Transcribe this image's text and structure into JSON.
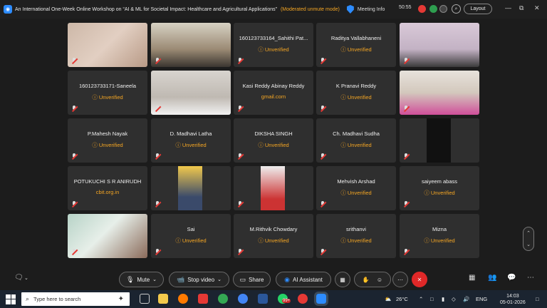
{
  "titlebar": {
    "title": "An International One-Week Online Workshop on “AI & ML for Societal Impact: Healthcare and Agricultural Applications”",
    "mode": "(Moderated unmute mode)",
    "meeting_info": "Meeting Info",
    "timer": "50:55",
    "layout_label": "Layout"
  },
  "participants": [
    {
      "name": "",
      "sub": ""
    },
    {
      "name": "",
      "sub": ""
    },
    {
      "name": "160123733164_Sahithi Pat...",
      "sub": "ⓘ Unverified"
    },
    {
      "name": "Raditya Vallabhaneni",
      "sub": "ⓘ Unverified"
    },
    {
      "name": "",
      "sub": ""
    },
    {
      "name": "160123733171-Saneela",
      "sub": "ⓘ Unverified"
    },
    {
      "name": "",
      "sub": ""
    },
    {
      "name": "Kasi Reddy Abinay Reddy",
      "sub": "gmail.com"
    },
    {
      "name": "K Pranavi Reddy",
      "sub": "ⓘ Unverified"
    },
    {
      "name": "",
      "sub": ""
    },
    {
      "name": "P.Mahesh Nayak",
      "sub": "ⓘ Unverified"
    },
    {
      "name": "D. Madhavi Latha",
      "sub": "ⓘ Unverified"
    },
    {
      "name": "DIKSHA SINGH",
      "sub": "ⓘ Unverified"
    },
    {
      "name": "Ch. Madhavi Sudha",
      "sub": "ⓘ Unverified"
    },
    {
      "name": "",
      "sub": ""
    },
    {
      "name": "POTUKUCHI S R ANIRUDH",
      "sub": "cbit.org.in"
    },
    {
      "name": "",
      "sub": ""
    },
    {
      "name": "",
      "sub": ""
    },
    {
      "name": "Mehvish Arshad",
      "sub": "ⓘ Unverified"
    },
    {
      "name": "saiyeem abass",
      "sub": "ⓘ Unverified"
    },
    {
      "name": "",
      "sub": ""
    },
    {
      "name": "Sai",
      "sub": "ⓘ Unverified"
    },
    {
      "name": "M.Rithvik Chowdary",
      "sub": "ⓘ Unverified"
    },
    {
      "name": "srithanvi",
      "sub": "ⓘ Unverified"
    },
    {
      "name": "Mizna",
      "sub": "ⓘ Unverified"
    }
  ],
  "controls": {
    "mute": "Mute",
    "stop_video": "Stop video",
    "share": "Share",
    "ai_assistant": "AI Assistant"
  },
  "taskbar": {
    "search_placeholder": "Type here to search",
    "temperature": "26°C",
    "language": "ENG",
    "time": "14:03",
    "date": "05-01-2026",
    "badge": "99+"
  },
  "colors": {
    "accent": "#2d8cff",
    "unverified": "#f5a623",
    "leave": "#e02828",
    "tile_bg": "#2f2f2f"
  }
}
